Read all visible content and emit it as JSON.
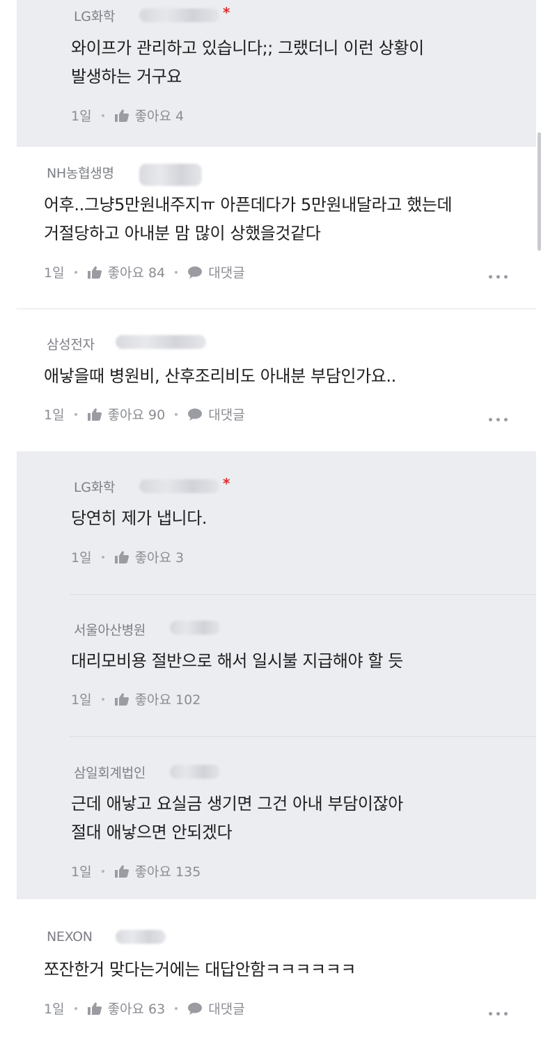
{
  "comments": [
    {
      "company": "LG화학",
      "lines": [
        "와이프가 관리하고 있습니다;; 그랬더니 이런 상황이",
        "발생하는 거구요"
      ],
      "time": "1일",
      "like_label": "좋아요 4"
    },
    {
      "company": "NH농협생명",
      "lines": [
        "어후..그냥5만원내주지ㅠ 아픈데다가 5만원내달라고 했는데",
        "거절당하고 아내분 맘 많이 상했을것같다"
      ],
      "time": "1일",
      "like_label": "좋아요 84",
      "reply_label": "대댓글"
    },
    {
      "company": "삼성전자",
      "lines": [
        "애낳을때 병원비, 산후조리비도 아내분 부담인가요.."
      ],
      "time": "1일",
      "like_label": "좋아요 90",
      "reply_label": "대댓글"
    },
    {
      "company": "LG화학",
      "lines": [
        "당연히 제가 냅니다."
      ],
      "time": "1일",
      "like_label": "좋아요 3"
    },
    {
      "company": "서울아산병원",
      "lines": [
        "대리모비용 절반으로 해서 일시불 지급해야 할 듯"
      ],
      "time": "1일",
      "like_label": "좋아요 102"
    },
    {
      "company": "삼일회계법인",
      "lines": [
        "근데 애낳고 요실금 생기면 그건 아내 부담이잖아",
        "절대 애낳으면 안되겠다"
      ],
      "time": "1일",
      "like_label": "좋아요 135"
    },
    {
      "company": "NEXON",
      "lines": [
        "쪼잔한거 맞다는거에는 대답안함ㅋㅋㅋㅋㅋㅋ"
      ],
      "time": "1일",
      "like_label": "좋아요 63",
      "reply_label": "대댓글"
    }
  ],
  "marks": {
    "author_star": "*"
  },
  "icons": {
    "like": "thumbs-up-icon",
    "reply": "speech-bubble-icon",
    "more": "more-dots-icon"
  }
}
